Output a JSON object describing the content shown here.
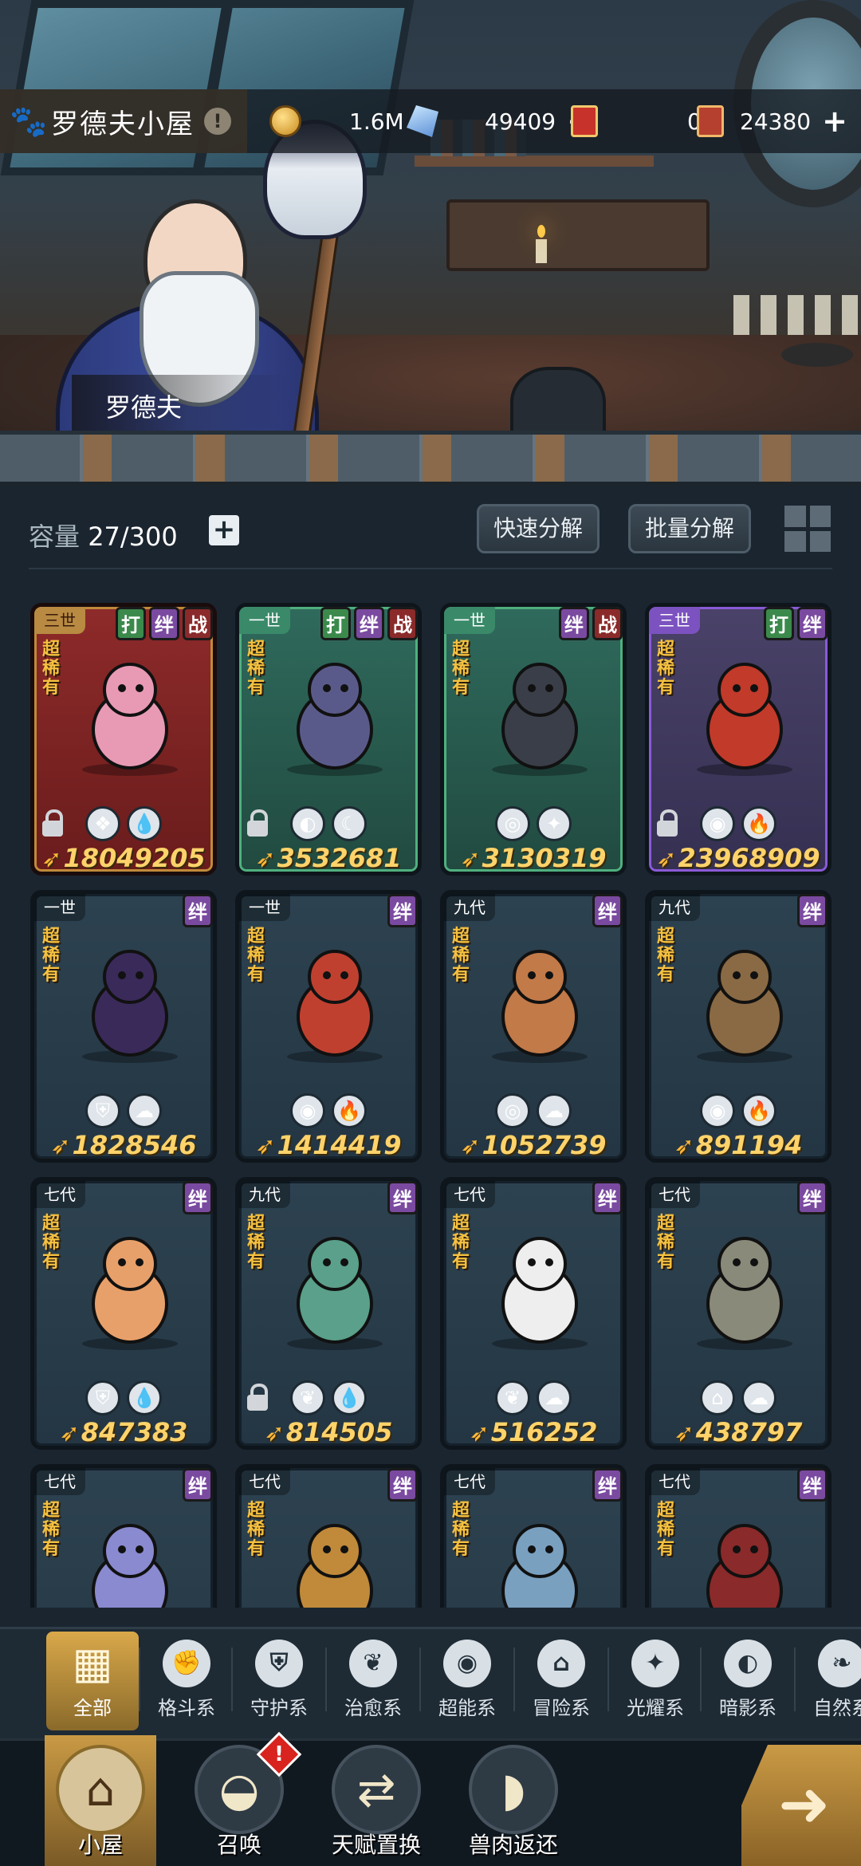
{
  "location": {
    "title": "罗德夫小屋",
    "paw_icon": "paw-icon",
    "info_label": "!"
  },
  "npc": {
    "name": "罗德夫"
  },
  "resources": {
    "gold": {
      "value": "1.6M",
      "icon": "gold-coin-icon"
    },
    "crystal": {
      "value": "49409",
      "icon": "crystal-icon",
      "plus": "+"
    },
    "ticket": {
      "value": "0",
      "icon": "summon-ticket-icon"
    },
    "card": {
      "value": "24380",
      "icon": "card-ticket-icon",
      "plus": "+"
    }
  },
  "toolbar": {
    "capacity_label": "容量",
    "capacity_value": "27/300",
    "capacity_plus": "+",
    "quick_decompose": "快速分解",
    "batch_decompose": "批量分解"
  },
  "cards": [
    {
      "gen": "三世",
      "tags": [
        "打",
        "绊",
        "战"
      ],
      "rarity": "超稀有",
      "locked": true,
      "elements": [
        "❖",
        "💧"
      ],
      "power": "18049205",
      "frame": "red",
      "palette": "#e89ab4"
    },
    {
      "gen": "一世",
      "tags": [
        "打",
        "绊",
        "战"
      ],
      "rarity": "超稀有",
      "locked": true,
      "elements": [
        "◐",
        "☾"
      ],
      "power": "3532681",
      "frame": "green",
      "palette": "#5a5a8a"
    },
    {
      "gen": "一世",
      "tags": [
        "绊",
        "战"
      ],
      "rarity": "超稀有",
      "locked": false,
      "elements": [
        "◎",
        "✦"
      ],
      "power": "3130319",
      "frame": "green",
      "palette": "#3a3e48"
    },
    {
      "gen": "三世",
      "tags": [
        "打",
        "绊"
      ],
      "rarity": "超稀有",
      "locked": true,
      "elements": [
        "◉",
        "🔥"
      ],
      "power": "23968909",
      "frame": "purple",
      "palette": "#c23a2a"
    },
    {
      "gen": "一世",
      "tags": [
        "绊"
      ],
      "rarity": "超稀有",
      "locked": false,
      "elements": [
        "⛨",
        "☁"
      ],
      "power": "1828546",
      "frame": "slate",
      "palette": "#3a2a5a"
    },
    {
      "gen": "一世",
      "tags": [
        "绊"
      ],
      "rarity": "超稀有",
      "locked": false,
      "elements": [
        "◉",
        "🔥"
      ],
      "power": "1414419",
      "frame": "slate",
      "palette": "#c04030"
    },
    {
      "gen": "九代",
      "tags": [
        "绊"
      ],
      "rarity": "超稀有",
      "locked": false,
      "elements": [
        "◎",
        "☁"
      ],
      "power": "1052739",
      "frame": "slate",
      "palette": "#c27a48"
    },
    {
      "gen": "九代",
      "tags": [
        "绊"
      ],
      "rarity": "超稀有",
      "locked": false,
      "elements": [
        "◉",
        "🔥"
      ],
      "power": "891194",
      "frame": "slate",
      "palette": "#8a6a44"
    },
    {
      "gen": "七代",
      "tags": [
        "绊"
      ],
      "rarity": "超稀有",
      "locked": false,
      "elements": [
        "⛨",
        "💧"
      ],
      "power": "847383",
      "frame": "slate",
      "palette": "#e8a06a"
    },
    {
      "gen": "九代",
      "tags": [
        "绊"
      ],
      "rarity": "超稀有",
      "locked": true,
      "elements": [
        "❦",
        "💧"
      ],
      "power": "814505",
      "frame": "slate",
      "palette": "#5aa08a"
    },
    {
      "gen": "七代",
      "tags": [
        "绊"
      ],
      "rarity": "超稀有",
      "locked": false,
      "elements": [
        "❦",
        "☁"
      ],
      "power": "516252",
      "frame": "slate",
      "palette": "#eeeeee"
    },
    {
      "gen": "七代",
      "tags": [
        "绊"
      ],
      "rarity": "超稀有",
      "locked": false,
      "elements": [
        "⌂",
        "☁"
      ],
      "power": "438797",
      "frame": "slate",
      "palette": "#8a8a7a"
    },
    {
      "gen": "七代",
      "tags": [
        "绊"
      ],
      "rarity": "超稀有",
      "locked": false,
      "elements": [],
      "power": "",
      "frame": "slate",
      "palette": "#8a8ad0"
    },
    {
      "gen": "七代",
      "tags": [
        "绊"
      ],
      "rarity": "超稀有",
      "locked": false,
      "elements": [],
      "power": "",
      "frame": "slate",
      "palette": "#c08a3a"
    },
    {
      "gen": "七代",
      "tags": [
        "绊"
      ],
      "rarity": "超稀有",
      "locked": false,
      "elements": [],
      "power": "",
      "frame": "slate",
      "palette": "#7aa0c0"
    },
    {
      "gen": "七代",
      "tags": [
        "绊"
      ],
      "rarity": "超稀有",
      "locked": false,
      "elements": [],
      "power": "",
      "frame": "slate",
      "palette": "#8a2a2a"
    }
  ],
  "categories": [
    {
      "label": "全部",
      "icon": "all-blocks-icon",
      "glyph": "▦",
      "active": true
    },
    {
      "label": "格斗系",
      "icon": "fist-icon",
      "glyph": "✊"
    },
    {
      "label": "守护系",
      "icon": "shield-icon",
      "glyph": "⛨"
    },
    {
      "label": "治愈系",
      "icon": "sprout-icon",
      "glyph": "❦"
    },
    {
      "label": "超能系",
      "icon": "alien-icon",
      "glyph": "◉"
    },
    {
      "label": "冒险系",
      "icon": "lantern-icon",
      "glyph": "⌂"
    },
    {
      "label": "光耀系",
      "icon": "star-cross-icon",
      "glyph": "✦"
    },
    {
      "label": "暗影系",
      "icon": "shadow-eye-icon",
      "glyph": "◐"
    },
    {
      "label": "自然系",
      "icon": "leaf-icon",
      "glyph": "❧"
    }
  ],
  "bottom_nav": [
    {
      "label": "小屋",
      "icon": "house-icon",
      "glyph": "⌂",
      "active": true
    },
    {
      "label": "召唤",
      "icon": "egg-icon",
      "glyph": "◒",
      "badge": "!"
    },
    {
      "label": "天赋置换",
      "icon": "swap-arrows-icon",
      "glyph": "⇄"
    },
    {
      "label": "兽肉返还",
      "icon": "meat-icon",
      "glyph": "◗"
    }
  ],
  "next_button": {
    "icon": "arrow-right-icon",
    "glyph": "➜"
  },
  "colors": {
    "power": "#ffd36a",
    "rarity": "#f5c140",
    "accent_gold": "#c99a45",
    "badge": "#d8231e"
  }
}
